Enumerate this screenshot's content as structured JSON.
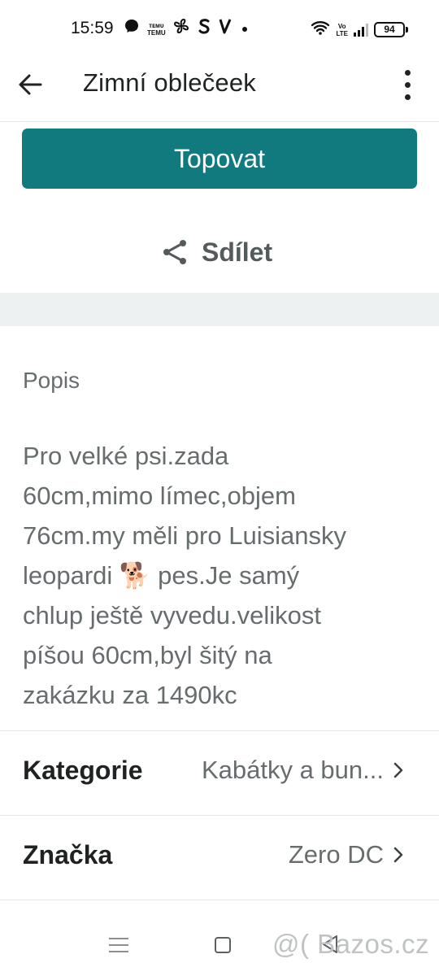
{
  "status_bar": {
    "time": "15:59",
    "temu_top": "ᴛᴇᴍᴜ",
    "temu_label": "TEMU",
    "volte_top": "Vo",
    "volte_bottom": "LTE",
    "battery": "94"
  },
  "app_bar": {
    "title": "Zimní oblečeek",
    "back_icon": "arrow-left-icon",
    "more_icon": "more-vertical-icon"
  },
  "actions": {
    "topovat_label": "Topovat",
    "share_label": "Sdílet",
    "share_icon": "share-icon"
  },
  "description": {
    "section_label": "Popis",
    "text": "Pro velké psi.zada\n60cm,mimo límec,objem\n76cm.my měli pro Luisiansky\nleopardi 🐕 pes.Je samý\nchlup ještě vyvedu.velikost\npíšou 60cm,byl šitý na\nzakázku za 1490kc"
  },
  "details": [
    {
      "label": "Kategorie",
      "value": "Kabátky a bun..."
    },
    {
      "label": "Značka",
      "value": "Zero DC"
    }
  ],
  "watermark": "@( Bazos.cz",
  "colors": {
    "accent": "#107a7f",
    "text_primary": "#1f2223",
    "text_secondary": "#676d6e",
    "divider": "#e4e7e8",
    "band": "#edf1f1"
  }
}
